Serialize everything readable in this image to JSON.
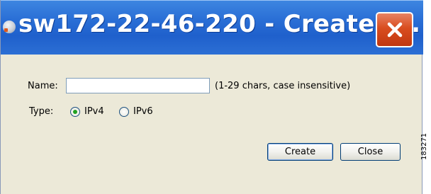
{
  "window": {
    "title": "sw172-22-46-220 - Create I...",
    "close_icon": "close-x-icon",
    "app_icon": "app-globe-icon",
    "colors": {
      "titlebar": "#2a6fd6",
      "close_button": "#d94d1f",
      "dialog_bg": "#ece9d8",
      "radio_selected": "#21a121"
    }
  },
  "form": {
    "name_label": "Name:",
    "name_value": "",
    "name_hint": "(1-29 chars, case insensitive)",
    "type_label": "Type:",
    "type_options": [
      {
        "label": "IPv4",
        "selected": true
      },
      {
        "label": "IPv6",
        "selected": false
      }
    ]
  },
  "buttons": {
    "create_label": "Create",
    "close_label": "Close"
  },
  "figure_id": "183271"
}
